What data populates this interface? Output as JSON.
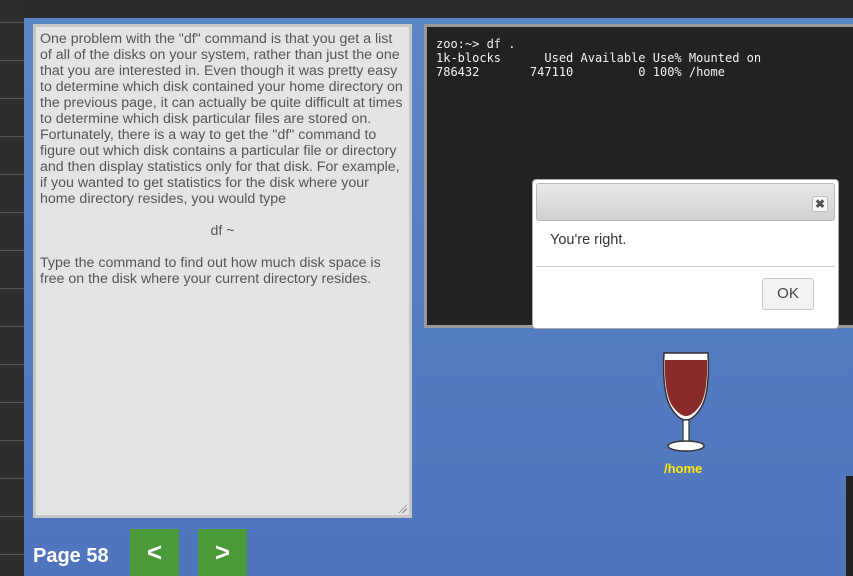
{
  "lesson": {
    "paragraph1": "One problem with the \"df\" command is that you get a list of all of the disks on your system, rather than just the one that you are interested in. Even though it was pretty easy to determine which disk contained your home directory on the previous page, it can actually be quite difficult at times to determine which disk particular files are stored on. Fortunately, there is a way to get the \"df\" command to figure out which disk contains a particular file or directory and then display statistics only for that disk. For example, if you wanted to get statistics for the disk where your home directory resides, you would type",
    "command": "df ~",
    "paragraph2": "Type the command to find out how much disk space is free on the disk where your current directory resides."
  },
  "terminal": {
    "line1": "zoo:~> df .",
    "line2": "1k-blocks      Used Available Use% Mounted on",
    "line3": "786432       747110         0 100% /home"
  },
  "dialog": {
    "message": "You're right.",
    "ok_label": "OK",
    "close_glyph": "✖"
  },
  "disk": {
    "label": "/home",
    "fill_percent": 100
  },
  "navigation": {
    "page_label": "Page 58",
    "prev_label": "<",
    "next_label": ">"
  },
  "colors": {
    "background_blue": "#5278bf",
    "nav_green": "#4b9a3a",
    "disk_label_yellow": "#ffea00",
    "wine_red": "#8b2a2a"
  }
}
